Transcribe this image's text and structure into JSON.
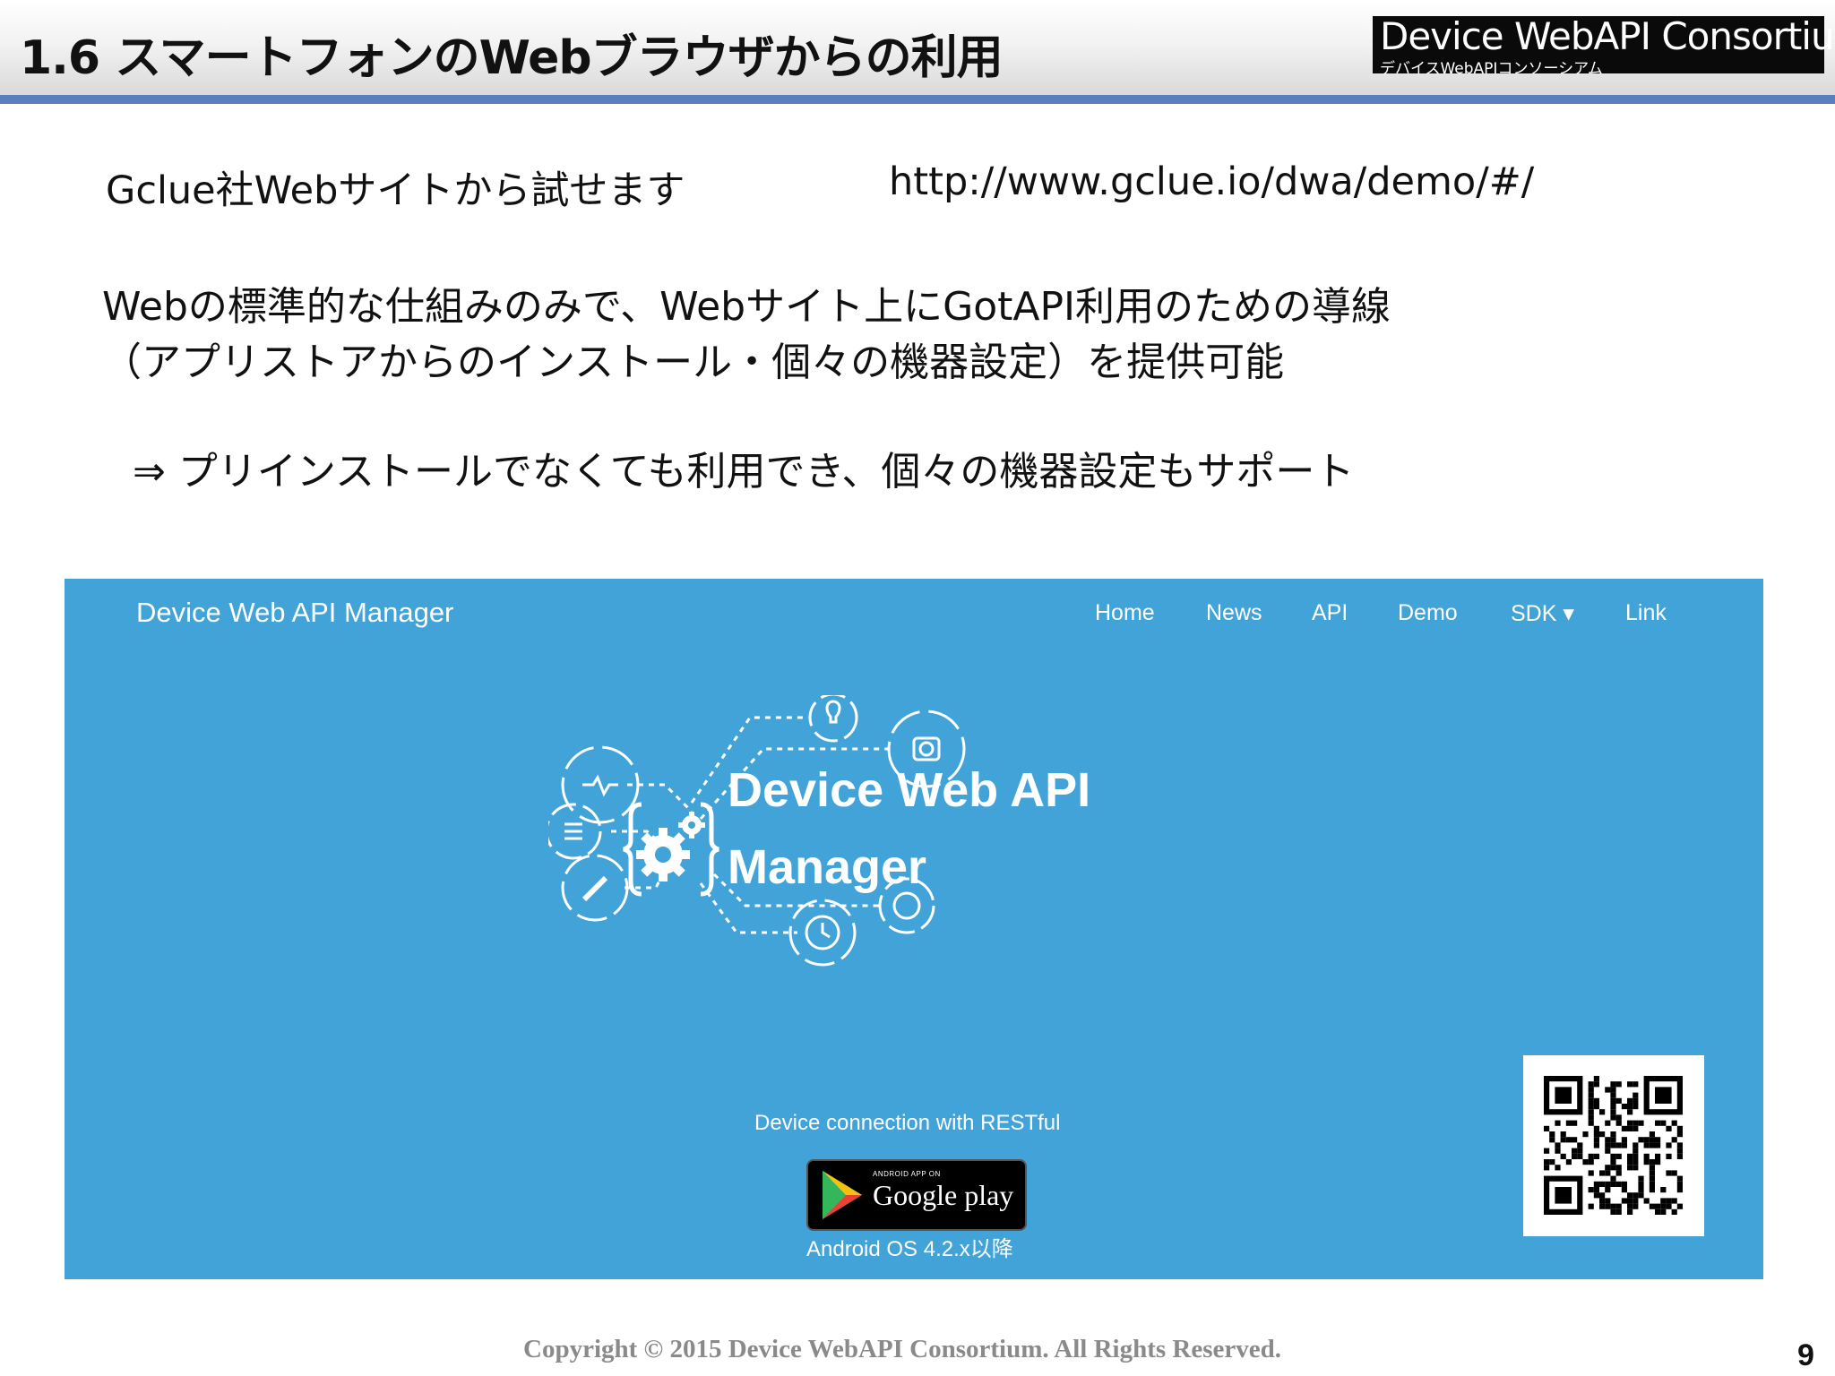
{
  "header": {
    "title": "1.6  スマートフォンのWebブラウザからの利用",
    "logo_main": "Device WebAPI Consortium",
    "logo_sub": "デバイスWebAPIコンソーシアム"
  },
  "body": {
    "line1": "Gclue社Webサイトから試せます",
    "url": "http://www.gclue.io/dwa/demo/#/",
    "line2": "Webの標準的な仕組みのみで、Webサイト上にGotAPI利用のための導線",
    "line3": "（アプリストアからのインストール・個々の機器設定）を提供可能",
    "line4": "⇒ プリインストールでなくても利用でき、個々の機器設定もサポート"
  },
  "screenshot": {
    "brand": "Device Web API Manager",
    "nav": [
      "Home",
      "News",
      "API",
      "Demo",
      "SDK ▾",
      "Link"
    ],
    "hero_line1": "Device Web API",
    "hero_line2": "Manager",
    "tagline": "Device connection with RESTful",
    "gplay_small": "ANDROID APP ON",
    "gplay_big": "Google play",
    "android_note": "Android OS 4.2.x以降"
  },
  "footer": {
    "copyright": "Copyright © 2015 Device WebAPI Consortium. All Rights Reserved.",
    "page_number": "9"
  },
  "colors": {
    "panel": "#42a3d8",
    "header_rule": "#5b7fbd"
  }
}
